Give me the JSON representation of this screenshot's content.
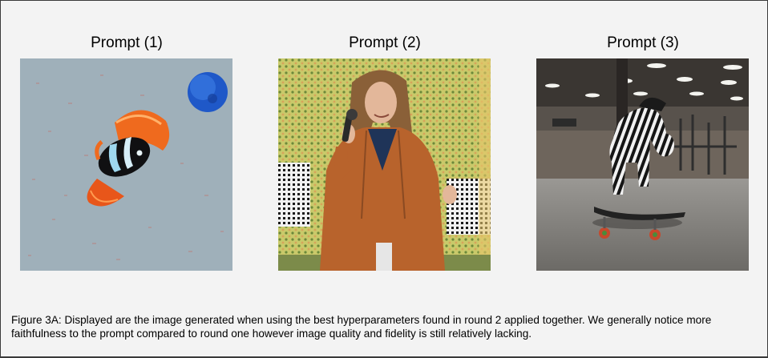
{
  "panels": [
    {
      "title": "Prompt (1)",
      "image_icon": "clownfish-and-blue-planet-image"
    },
    {
      "title": "Prompt (2)",
      "image_icon": "long-haired-singer-with-microphone-image"
    },
    {
      "title": "Prompt (3)",
      "image_icon": "zebra-on-skateboard-in-gym-image"
    }
  ],
  "caption": "Figure 3A: Displayed are the image generated when using the best hyperparameters found in round 2 applied together. We generally notice more faithfulness to the prompt compared to round one however image quality and fidelity is still relatively lacking.",
  "colors": {
    "background": "#f3f3f3",
    "border": "#3a3a3a"
  }
}
